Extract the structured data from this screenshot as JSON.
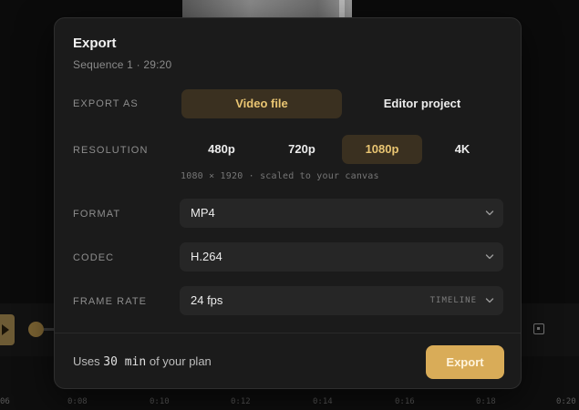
{
  "dialog": {
    "title": "Export",
    "subtitle": "Sequence 1 · 29:20"
  },
  "export_as": {
    "label": "EXPORT AS",
    "options": [
      "Video file",
      "Editor project"
    ],
    "selected": "Video file"
  },
  "resolution": {
    "label": "RESOLUTION",
    "options": [
      "480p",
      "720p",
      "1080p",
      "4K"
    ],
    "selected": "1080p",
    "hint": "1080 × 1920 · scaled to your canvas"
  },
  "format": {
    "label": "FORMAT",
    "value": "MP4"
  },
  "codec": {
    "label": "CODEC",
    "value": "H.264"
  },
  "frame_rate": {
    "label": "FRAME RATE",
    "value": "24 fps",
    "badge": "TIMELINE"
  },
  "footer": {
    "prefix": "Uses",
    "amount": "30 min",
    "suffix": "of your plan",
    "export_label": "Export"
  },
  "timeline": {
    "ticks": [
      "06",
      "0:08",
      "0:10",
      "0:12",
      "0:14",
      "0:16",
      "0:18",
      "0:20"
    ]
  },
  "icons": {
    "chevron": "chevron-down-icon",
    "play": "play-icon",
    "fit": "fit-to-screen-icon"
  },
  "colors": {
    "accent": "#d9ac58",
    "accent_text": "#e9c572",
    "accent_bg": "#3a3020",
    "dialog_bg": "#1b1b1b",
    "field_bg": "#262626"
  }
}
